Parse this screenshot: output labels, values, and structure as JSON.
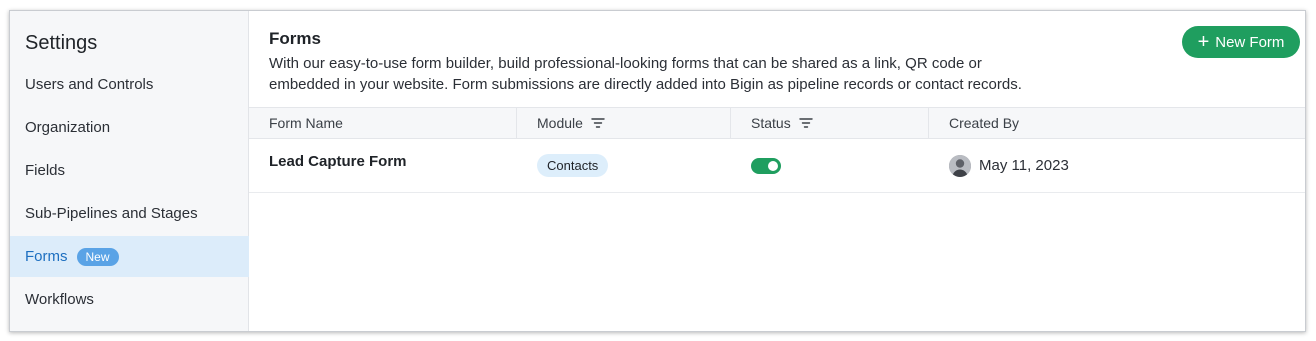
{
  "sidebar": {
    "title": "Settings",
    "items": [
      {
        "label": "Users and Controls"
      },
      {
        "label": "Organization"
      },
      {
        "label": "Fields"
      },
      {
        "label": "Sub-Pipelines and Stages"
      },
      {
        "label": "Forms",
        "badge": "New",
        "active": true
      },
      {
        "label": "Workflows"
      }
    ]
  },
  "main": {
    "title": "Forms",
    "description": "With our easy-to-use form builder, build professional-looking forms that can be shared as a link, QR code or embedded in your website. Form submissions are directly added into Bigin as pipeline records or contact records.",
    "new_button_label": "New Form",
    "table": {
      "columns": [
        "Form Name",
        "Module",
        "Status",
        "Created By"
      ],
      "rows": [
        {
          "form_name": "Lead Capture Form",
          "module": "Contacts",
          "status_enabled": true,
          "created_date": "May 11, 2023"
        }
      ]
    }
  },
  "colors": {
    "accent": "#1f9e5f",
    "active_nav_bg": "#dcecfa",
    "active_nav_text": "#1d6fc0",
    "badge_bg": "#5aa3e6",
    "chip_bg": "#ddeefb"
  }
}
